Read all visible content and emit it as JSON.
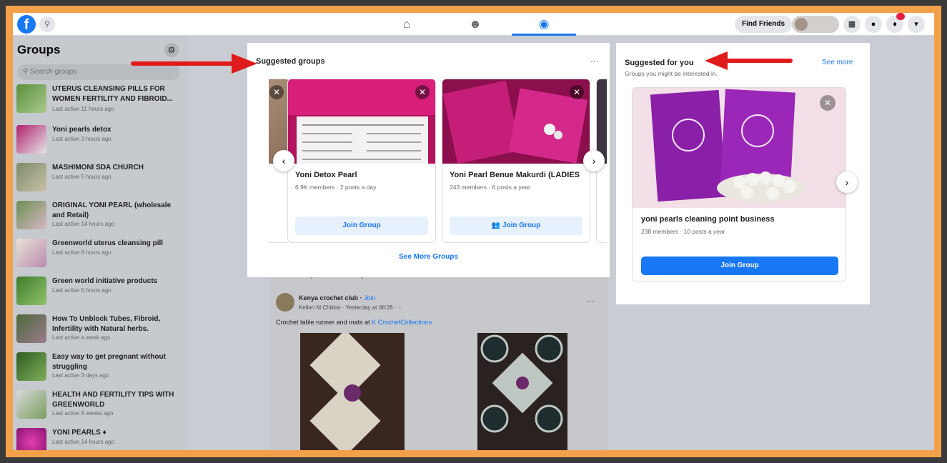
{
  "topbar": {
    "logo": "f",
    "find_friends": "Find Friends",
    "colors": {
      "brand": "#1877f2",
      "badge": "#e41e3f"
    },
    "icons": [
      "search-icon",
      "home-icon",
      "friends-icon",
      "groups-icon",
      "menu-grid-icon",
      "messenger-icon",
      "bell-icon",
      "chevron-down-icon"
    ]
  },
  "sidebar": {
    "title": "Groups",
    "search_placeholder": "Search groups",
    "groups": [
      {
        "name": "UTERUS CLEANSING PILLS FOR WOMEN FERTILITY AND FIBROID...",
        "meta": "Last active 11 hours ago"
      },
      {
        "name": "Yoni pearls detox",
        "meta": "Last active 3 hours ago"
      },
      {
        "name": "MASHIMONI SDA CHURCH",
        "meta": "Last active 5 hours ago"
      },
      {
        "name": "ORIGINAL YONI PEARL (wholesale and Retail)",
        "meta": "Last active 14 hours ago"
      },
      {
        "name": "Greenworld uterus cleansing pill",
        "meta": "Last active 8 hours ago"
      },
      {
        "name": "Green world initiative products",
        "meta": "Last active 5 hours ago"
      },
      {
        "name": "How To Unblock Tubes, Fibroid, Infertility with Natural herbs.",
        "meta": "Last active a week ago"
      },
      {
        "name": "Easy way to get pregnant without struggling",
        "meta": "Last active 3 days ago"
      },
      {
        "name": "HEALTH AND FERTILITY TIPS WITH GREENWORLD",
        "meta": "Last active 8 weeks ago"
      },
      {
        "name": "YONI PEARLS ♦",
        "meta": "Last active 14 hours ago"
      }
    ]
  },
  "suggested_groups": {
    "title": "Suggested groups",
    "more_icon": "···",
    "cards": [
      {
        "name": "Yoni Detox Pearl",
        "meta": "6.9K members · 2 posts a day",
        "button": "Join Group"
      },
      {
        "name": "Yoni Pearl Benue Makurdi (LADIES",
        "meta": "243 members · 6 posts a year",
        "button": "👥 Join Group"
      }
    ],
    "see_more": "See More Groups"
  },
  "suggested_for_you": {
    "title": "Suggested for you",
    "subtitle": "Groups you might be interested in.",
    "see_more": "See more",
    "card": {
      "name": "yoni pearls cleaning point business",
      "meta": "238 members · 10 posts a year",
      "button": "Join Group"
    }
  },
  "feed": {
    "note": "Based on your recent activity",
    "post": {
      "group": "Kenya crochet club",
      "join": "Join",
      "author_line": "Kellen M Chikira · Yesterday at 08:28 · ◌",
      "text_prefix": "Crochet table runner and mats at ",
      "text_link": "K CrochetCollections"
    }
  }
}
